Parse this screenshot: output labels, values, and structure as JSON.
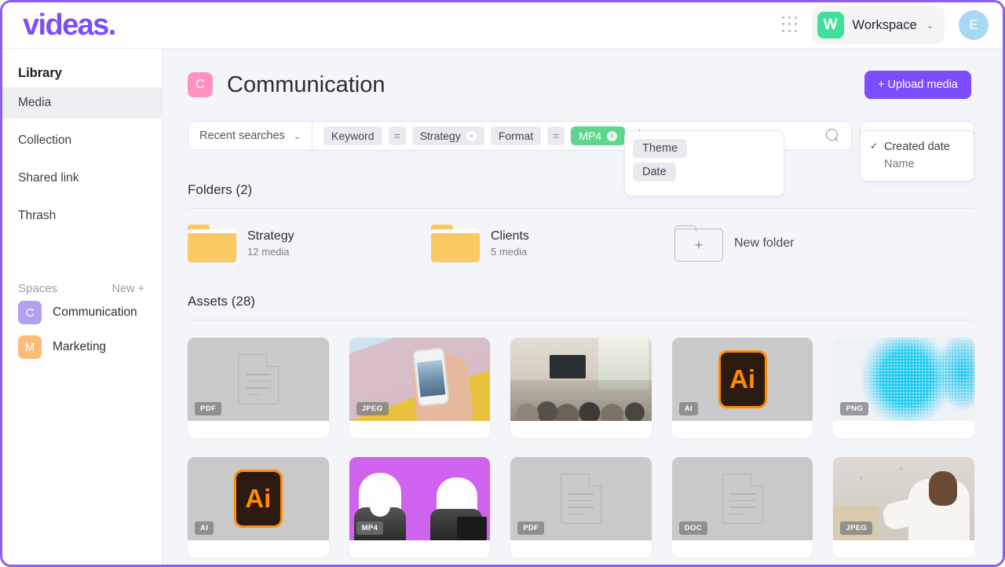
{
  "header": {
    "logo": "videas.",
    "grid_icon": "apps-grid-icon",
    "workspace_badge": "W",
    "workspace_label": "Workspace",
    "workspace_chevron": "⌄",
    "avatar_initial": "E",
    "badge_color": "#3ee09a",
    "avatar_color": "#a9d8f5",
    "brand_color": "#7c4dff"
  },
  "sidebar": {
    "heading": "Library",
    "items": [
      {
        "label": "Media",
        "active": true
      },
      {
        "label": "Collection",
        "active": false
      },
      {
        "label": "Shared link",
        "active": false
      },
      {
        "label": "Thrash",
        "active": false
      }
    ],
    "spaces_label": "Spaces",
    "spaces_new": "New +",
    "spaces": [
      {
        "initial": "C",
        "label": "Communication",
        "color": "#b3a0ee"
      },
      {
        "initial": "M",
        "label": "Marketing",
        "color": "#fbbd77"
      }
    ]
  },
  "page": {
    "badge_initial": "C",
    "badge_color": "#ff92c2",
    "title": "Communication",
    "upload_label": "+ Upload media"
  },
  "search": {
    "recent_label": "Recent searches",
    "recent_chevron": "⌄",
    "placeholder": "",
    "value": "",
    "search_icon": "search-icon",
    "filters": [
      {
        "key": "Keyword",
        "op": "=",
        "value": "Strategy",
        "close": "×",
        "active": false
      },
      {
        "key": "Format",
        "op": "=",
        "value": "MP4",
        "close": "×",
        "active": true
      }
    ],
    "active_chip_color": "#5ed68e",
    "suggestions": [
      "Theme",
      "Date"
    ]
  },
  "sort": {
    "label": "Created date",
    "chevron": "⌄",
    "options": [
      {
        "label": "Created date",
        "selected": true
      },
      {
        "label": "Name",
        "selected": false
      }
    ],
    "check": "✓"
  },
  "folders_section": {
    "title": "Folders (2)",
    "folders": [
      {
        "name": "Strategy",
        "meta": "12 media"
      },
      {
        "name": "Clients",
        "meta": "5 media"
      }
    ],
    "new_folder_label": "New folder",
    "new_folder_plus": "+"
  },
  "assets_section": {
    "title": "Assets (28)",
    "assets": [
      {
        "badge": "PDF",
        "kind": "doc"
      },
      {
        "badge": "JPEG",
        "kind": "photo-phone"
      },
      {
        "badge": "",
        "kind": "photo-conference"
      },
      {
        "badge": "AI",
        "kind": "ai"
      },
      {
        "badge": "PNG",
        "kind": "photo-png"
      },
      {
        "badge": "AI",
        "kind": "ai"
      },
      {
        "badge": "MP4",
        "kind": "photo-mp4"
      },
      {
        "badge": "PDF",
        "kind": "doc"
      },
      {
        "badge": "DOC",
        "kind": "doc"
      },
      {
        "badge": "JPEG",
        "kind": "photo-portrait"
      }
    ]
  }
}
